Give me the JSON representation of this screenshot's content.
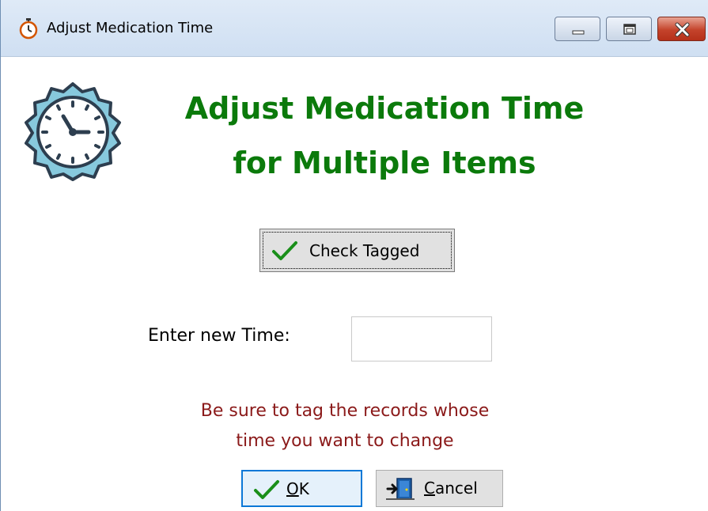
{
  "window": {
    "title": "Adjust Medication Time",
    "icon": "stopwatch-icon",
    "controls": [
      "minimize-icon",
      "maximize-icon",
      "close-icon"
    ]
  },
  "header": {
    "icon": "clock-icon",
    "title_line1": "Adjust Medication Time",
    "title_line2": "for Multiple Items"
  },
  "check_button": {
    "label": "Check Tagged",
    "icon": "checkmark-icon"
  },
  "time_field": {
    "label": "Enter new Time:",
    "value": ""
  },
  "warning": {
    "line1": "Be sure to tag the records whose",
    "line2": "time you want to change"
  },
  "ok_button": {
    "label_mnemonic": "O",
    "label_rest": "K",
    "icon": "checkmark-icon"
  },
  "cancel_button": {
    "label_mnemonic": "C",
    "label_rest": "ancel",
    "icon": "exit-door-icon"
  },
  "colors": {
    "heading": "#0b7a0b",
    "warning": "#8b1a1a",
    "titlebar": "#d6e4f4",
    "close_button": "#c4432b",
    "focus_border": "#0b78d7"
  }
}
